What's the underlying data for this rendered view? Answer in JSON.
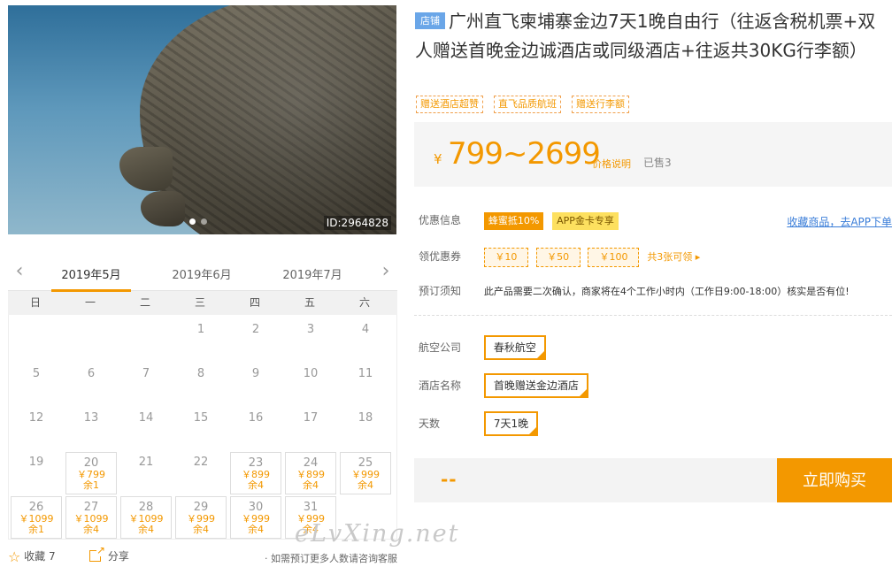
{
  "hero": {
    "image_id": "ID:2964828"
  },
  "calendar": {
    "months": [
      "2019年5月",
      "2019年6月",
      "2019年7月"
    ],
    "weekdays": [
      "日",
      "一",
      "二",
      "三",
      "四",
      "五",
      "六"
    ],
    "plain_days": [
      "1",
      "2",
      "3",
      "4",
      "5",
      "6",
      "7",
      "8",
      "9",
      "10",
      "11",
      "12",
      "13",
      "14",
      "15",
      "16",
      "17",
      "18",
      "19",
      "21",
      "22"
    ],
    "avail_days": [
      {
        "day": "20",
        "price": "￥799",
        "stock": "余1"
      },
      {
        "day": "23",
        "price": "￥899",
        "stock": "余4"
      },
      {
        "day": "24",
        "price": "￥899",
        "stock": "余4"
      },
      {
        "day": "25",
        "price": "￥999",
        "stock": "余4"
      },
      {
        "day": "26",
        "price": "￥1099",
        "stock": "余1"
      },
      {
        "day": "27",
        "price": "￥1099",
        "stock": "余4"
      },
      {
        "day": "28",
        "price": "￥1099",
        "stock": "余4"
      },
      {
        "day": "29",
        "price": "￥999",
        "stock": "余4"
      },
      {
        "day": "30",
        "price": "￥999",
        "stock": "余4"
      },
      {
        "day": "31",
        "price": "￥999",
        "stock": "余4"
      }
    ]
  },
  "footer": {
    "fav_label": "收藏 7",
    "share_label": "分享",
    "note": "· 如需预订更多人数请咨询客服"
  },
  "product": {
    "shop_tag": "店铺",
    "title": "广州直飞柬埔寨金边7天1晚自由行（往返含税机票+双人赠送首晚金边诚酒店或同级酒店+往返共30KG行李额）",
    "tags": [
      "赠送酒店超赞",
      "直飞品质航班",
      "赠送行李额"
    ],
    "price_yen": "¥",
    "price_range": "799~2699",
    "price_explain": "价格说明",
    "sold": "已售3"
  },
  "info": {
    "youhui_label": "优惠信息",
    "badge1": "蜂蜜抵10%",
    "badge2": "APP金卡专享",
    "fav_link": "收藏商品，去APP下单",
    "quan_label": "领优惠券",
    "coupons": [
      "￥10",
      "￥50",
      "￥100"
    ],
    "coupon_more": "共3张可领 ▸",
    "xuzhi_label": "预订须知",
    "xuzhi_text": "此产品需要二次确认，商家将在4个工作小时内（工作日9:00-18:00）核实是否有位!"
  },
  "options": {
    "airline_label": "航空公司",
    "airline_value": "春秋航空",
    "hotel_label": "酒店名称",
    "hotel_value": "首晚赠送金边酒店",
    "days_label": "天数",
    "days_value": "7天1晚"
  },
  "buy": {
    "qty": "--",
    "button": "立即购买"
  },
  "watermark": "eLvXing.net"
}
